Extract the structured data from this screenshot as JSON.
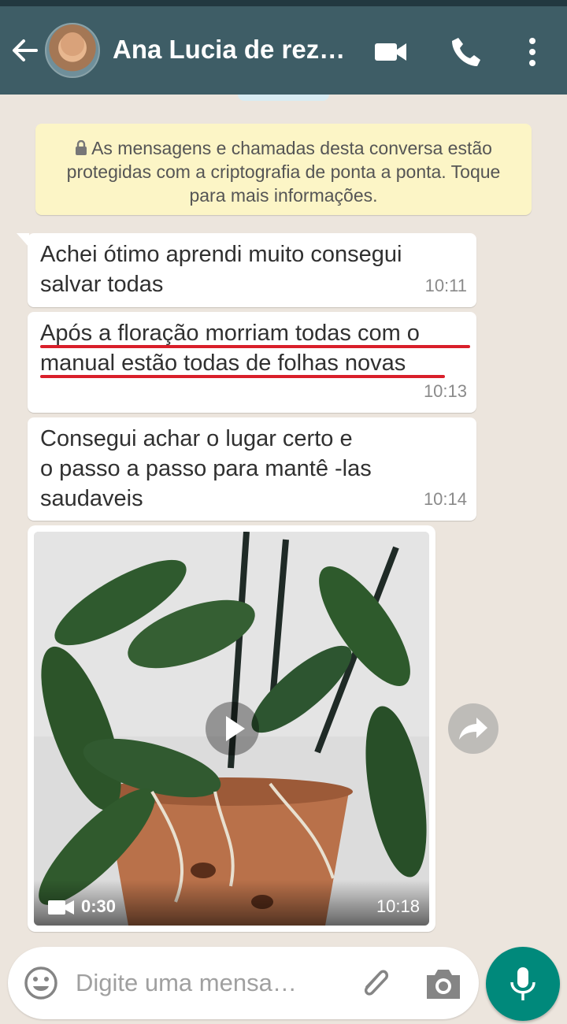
{
  "header": {
    "contact_name": "Ana Lucia de rez…",
    "icons": [
      "back-arrow-icon",
      "video-call-icon",
      "voice-call-icon",
      "more-options-icon"
    ]
  },
  "encryption_notice": {
    "text": "As mensagens e chamadas desta conversa estão protegidas com a criptografia de ponta a ponta. Toque para mais informações."
  },
  "messages": [
    {
      "lines": [
        "Achei ótimo aprendi muito consegui",
        "salvar todas"
      ],
      "time": "10:11"
    },
    {
      "lines": [
        "Após a floração morriam todas com o",
        "manual estão todas de folhas novas"
      ],
      "time": "10:13",
      "underlined": true
    },
    {
      "lines": [
        "Consegui achar o lugar certo e",
        "o passo a passo para mantê -las",
        "saudaveis"
      ],
      "time": "10:14"
    }
  ],
  "video_message": {
    "duration": "0:30",
    "time": "10:18"
  },
  "composer": {
    "placeholder": "Digite uma mensa…"
  },
  "colors": {
    "header": "#3e5d66",
    "wallpaper": "#ece5dd",
    "notice_bg": "#fcf5c6",
    "accent": "#00897b",
    "underline": "#d91f2a"
  }
}
